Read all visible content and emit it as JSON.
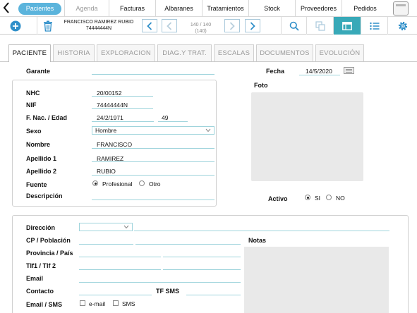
{
  "nav": {
    "back_icon": "chevron-left-icon",
    "tabs": [
      "Pacientes",
      "Agenda",
      "Facturas",
      "Albaranes",
      "Tratamientos",
      "Stock",
      "Proveedores",
      "Pedidos"
    ]
  },
  "toolbar": {
    "record_line1": "FRANCISCO RAMIREZ RUBIO",
    "record_line2": "74444444N",
    "counter_line1": "140 / 140",
    "counter_line2": "(140)",
    "icon_color": "#2f8fc9",
    "active_color": "#38a9b8"
  },
  "tabs": [
    "PACIENTE",
    "HISTORIA",
    "EXPLORACION",
    "DIAG.Y TRAT.",
    "ESCALAS",
    "DOCUMENTOS",
    "EVOLUCIÓN"
  ],
  "form": {
    "garante_label": "Garante",
    "fecha_label": "Fecha",
    "fecha_value": "14/5/2020",
    "foto_label": "Foto",
    "nhc_label": "NHC",
    "nhc_value": "20/00152",
    "nif_label": "NIF",
    "nif_value": "74444444N",
    "fnac_label": "F. Nac. / Edad",
    "fnac_value": "24/2/1971",
    "edad_value": "49",
    "sexo_label": "Sexo",
    "sexo_value": "Hombre",
    "nombre_label": "Nombre",
    "nombre_value": "FRANCISCO",
    "apellido1_label": "Apellido 1",
    "apellido1_value": "RAMIREZ",
    "apellido2_label": "Apellido 2",
    "apellido2_value": "RUBIO",
    "fuente_label": "Fuente",
    "fuente_opt1": "Profesional",
    "fuente_opt2": "Otro",
    "descripcion_label": "Descripción",
    "activo_label": "Activo",
    "activo_opt1": "SI",
    "activo_opt2": "NO",
    "direccion_label": "Dirección",
    "cp_label": "CP / Población",
    "notas_label": "Notas",
    "provincia_label": "Provincia / País",
    "tlf_label": "Tlf1 / Tlf 2",
    "email_label": "Email",
    "contacto_label": "Contacto",
    "tfsms_label": "TF SMS",
    "emailsms_label": "Email / SMS",
    "emailsms_opt1": "e-mail",
    "emailsms_opt2": "SMS"
  }
}
